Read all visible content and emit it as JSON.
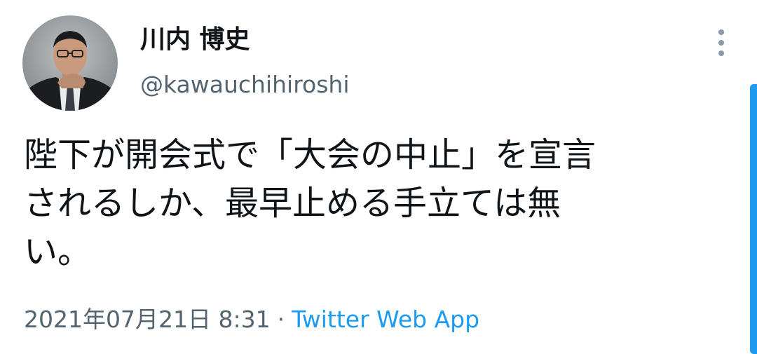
{
  "author": {
    "display_name": "川内 博史",
    "handle": "@kawauchihiroshi"
  },
  "tweet": {
    "lines": [
      "陛下が開会式で「大会の中止」を宣言",
      "されるしか、最早止める手立ては無",
      "い。"
    ]
  },
  "meta": {
    "timestamp": "2021年07月21日 8:31",
    "separator": "·",
    "source": "Twitter Web App"
  },
  "icons": {
    "more": "more-vertical-icon",
    "avatar": "avatar-photo"
  },
  "colors": {
    "text": "#0f1419",
    "secondary": "#536471",
    "link": "#1d9bf0"
  }
}
